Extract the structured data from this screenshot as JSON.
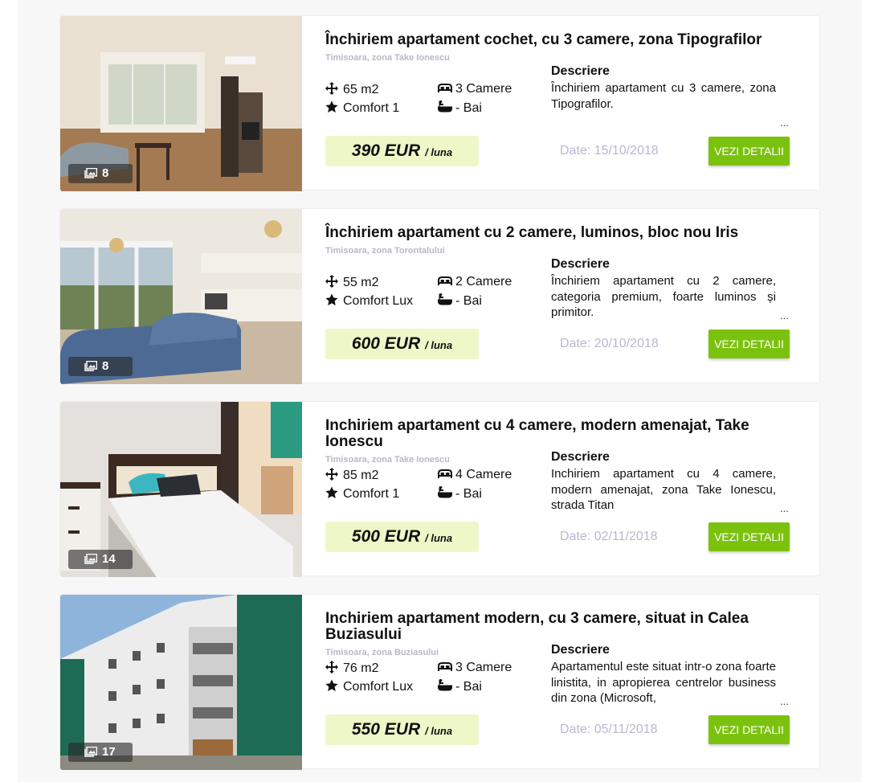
{
  "listings": [
    {
      "title": "Închiriem apartament cochet, cu 3 camere, zona Tipografilor",
      "location": "Timisoara, zona Take Ionescu",
      "area": "65 m2",
      "rooms": "3 Camere",
      "comfort": "Comfort 1",
      "baths": "- Bai",
      "desc_heading": "Descriere",
      "description": "Închiriem apartament cu 3 camere, zona Tipografilor.",
      "more": "...",
      "price": "390 EUR",
      "price_period": "/ luna",
      "date": "Date: 15/10/2018",
      "button": "VEZI DETALII",
      "photos": "8",
      "photo_icon": "images-icon"
    },
    {
      "title": "Închiriem apartament cu 2 camere, luminos, bloc nou Iris",
      "location": "Timisoara, zona Torontalului",
      "area": "55 m2",
      "rooms": "2 Camere",
      "comfort": "Comfort Lux",
      "baths": "- Bai",
      "desc_heading": "Descriere",
      "description": "Închiriem apartament cu 2 camere, categoria premium, foarte luminos și primitor.",
      "more": "...",
      "price": "600 EUR",
      "price_period": "/ luna",
      "date": "Date: 20/10/2018",
      "button": "VEZI DETALII",
      "photos": "8",
      "photo_icon": "images-icon"
    },
    {
      "title": "Inchiriem apartament cu 4 camere, modern amenajat, Take Ionescu",
      "location": "Timisoara, zona Take Ionescu",
      "area": "85 m2",
      "rooms": "4 Camere",
      "comfort": "Comfort 1",
      "baths": "- Bai",
      "desc_heading": "Descriere",
      "description": "Inchiriem apartament cu 4 camere, modern amenajat, zona Take Ionescu, strada Titan",
      "more": "...",
      "price": "500 EUR",
      "price_period": "/ luna",
      "date": "Date: 02/11/2018",
      "button": "VEZI DETALII",
      "photos": "14",
      "photo_icon": "images-icon"
    },
    {
      "title": "Inchiriem apartament modern, cu 3 camere, situat in Calea Buziasului",
      "location": "Timisoara, zona Buziasului",
      "area": "76 m2",
      "rooms": "3 Camere",
      "comfort": "Comfort Lux",
      "baths": "- Bai",
      "desc_heading": "Descriere",
      "description": "Apartamentul este situat intr-o zona foarte linistita, in apropierea centrelor business din zona (Microsoft,",
      "more": "...",
      "price": "550 EUR",
      "price_period": "/ luna",
      "date": "Date: 05/11/2018",
      "button": "VEZI DETALII",
      "photos": "17",
      "photo_icon": "images-icon"
    }
  ],
  "colors": {
    "button": "#7bc20e",
    "price_bg": "#eef7c8",
    "date": "#b8b8d0",
    "location": "#b8b8c8"
  }
}
